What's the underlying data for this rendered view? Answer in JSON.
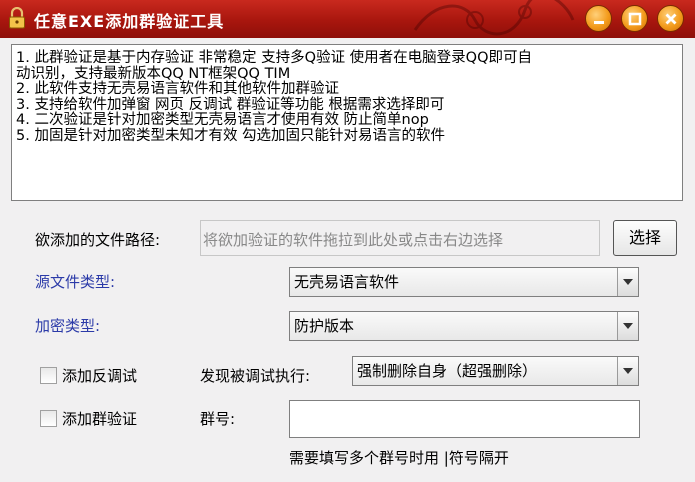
{
  "window": {
    "title": "任意EXE添加群验证工具"
  },
  "info_lines": [
    "1. 此群验证是基于内存验证 非常稳定 支持多Q验证 使用者在电脑登录QQ即可自",
    "动识别，支持最新版本QQ NT框架QQ TIM",
    "2. 此软件支持无壳易语言软件和其他软件加群验证",
    "3. 支持给软件加弹窗 网页 反调试 群验证等功能 根据需求选择即可",
    "4. 二次验证是针对加密类型无壳易语言才使用有效 防止简单nop",
    "5. 加固是针对加密类型未知才有效   勾选加固只能针对易语言的软件"
  ],
  "file_path": {
    "label": "欲添加的文件路径:",
    "placeholder": "将欲加验证的软件拖拉到此处或点击右边选择",
    "button": "选择"
  },
  "source_type": {
    "label": "源文件类型:",
    "value": "无壳易语言软件"
  },
  "encrypt_type": {
    "label": "加密类型:",
    "value": "防护版本"
  },
  "anti_debug": {
    "label": "添加反调试",
    "checked": false,
    "action_label": "发现被调试执行:",
    "action_value": "强制删除自身（超强删除）"
  },
  "group_verify": {
    "label": "添加群验证",
    "checked": false,
    "group_label": "群号:",
    "group_value": "",
    "hint": "需要填写多个群号时用 |符号隔开"
  }
}
